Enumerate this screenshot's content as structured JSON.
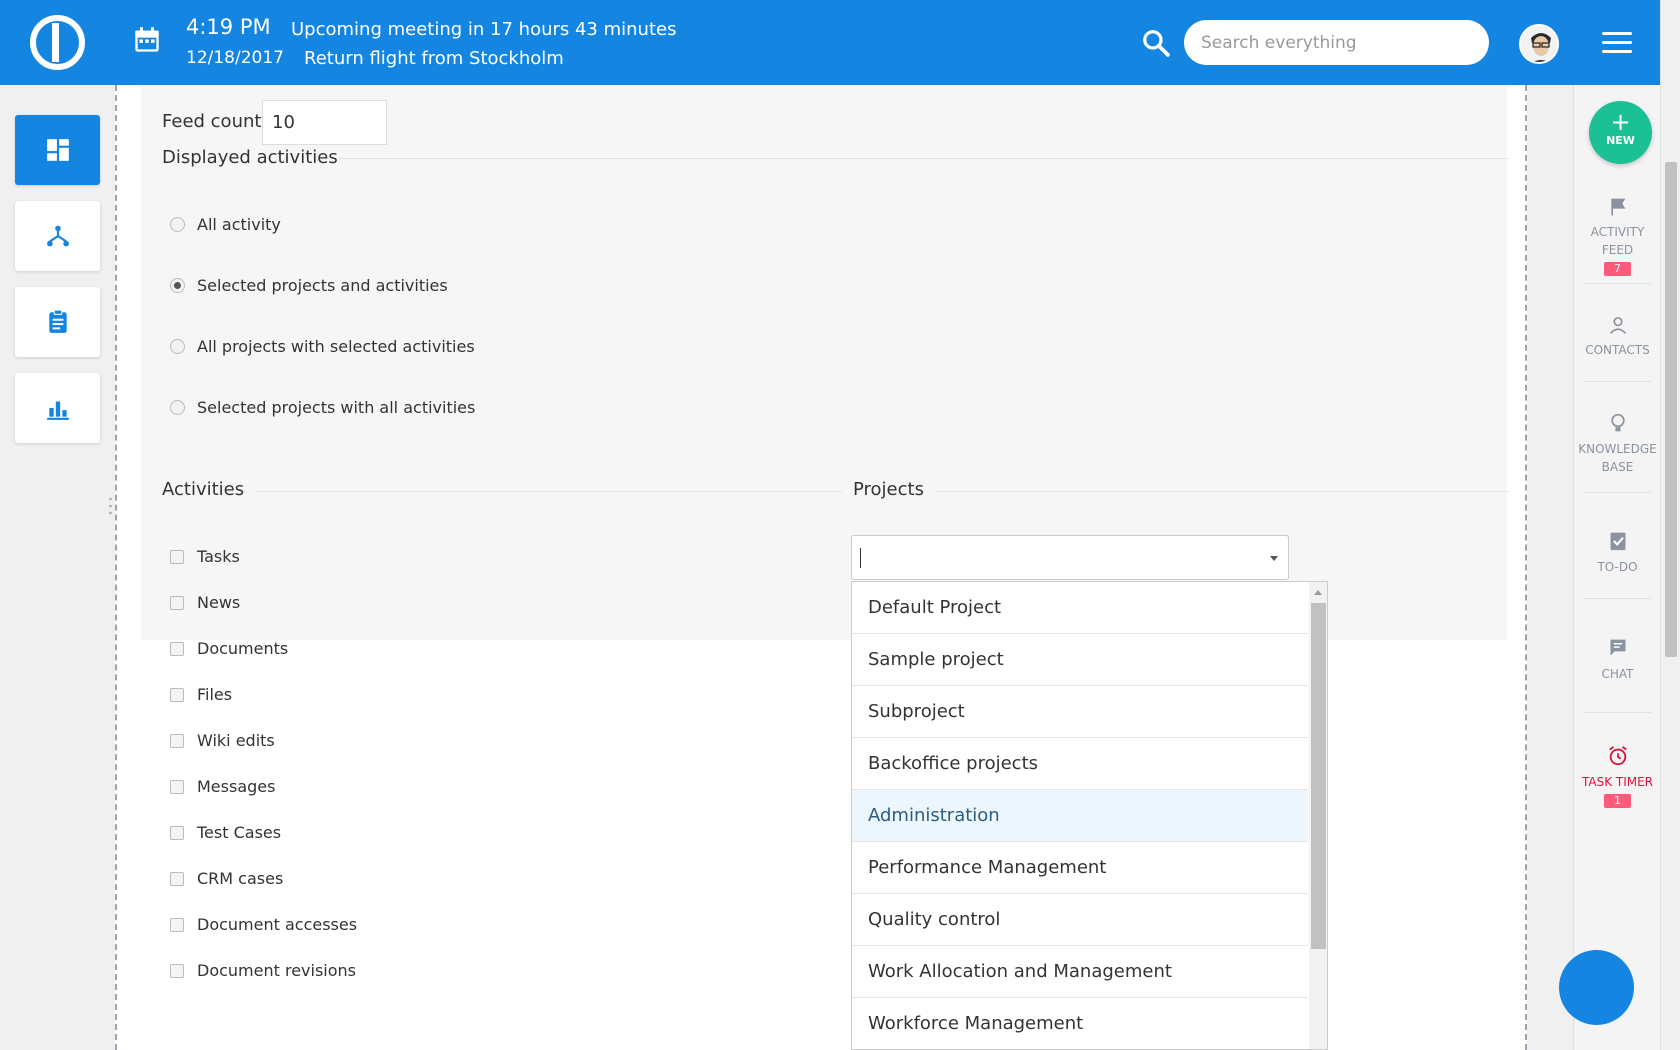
{
  "header": {
    "time": "4:19 PM",
    "date": "12/18/2017",
    "meeting": "Upcoming meeting in 17 hours 43 minutes",
    "flight": "Return flight from Stockholm",
    "search_placeholder": "Search everything"
  },
  "form": {
    "feed_count_label": "Feed count",
    "feed_count_value": "10",
    "displayed_activities_label": "Displayed activities",
    "radio_options": [
      "All activity",
      "Selected projects and activities",
      "All projects with selected activities",
      "Selected projects with all activities"
    ],
    "selected_radio": 1,
    "activities_label": "Activities",
    "projects_label": "Projects",
    "activities": [
      "Tasks",
      "News",
      "Documents",
      "Files",
      "Wiki edits",
      "Messages",
      "Test Cases",
      "CRM cases",
      "Document accesses",
      "Document revisions"
    ]
  },
  "dropdown": {
    "items": [
      "Default Project",
      "Sample project",
      "Subproject",
      "Backoffice projects",
      "Administration",
      "Performance Management",
      "Quality control",
      "Work Allocation and Management",
      "Workforce Management"
    ],
    "highlighted": 4
  },
  "rail": {
    "new_label": "NEW",
    "activity_feed_line1": "ACTIVITY",
    "activity_feed_line2": "FEED",
    "activity_feed_badge": "7",
    "contacts": "CONTACTS",
    "knowledge_line1": "KNOWLEDGE",
    "knowledge_line2": "BASE",
    "todo": "TO-DO",
    "chat": "CHAT",
    "timer": "TASK TIMER",
    "timer_badge": "1"
  },
  "colors": {
    "brand": "#1485e0",
    "new_button": "#1bc094",
    "badge": "#ff5a7a",
    "timer": "#d9143c"
  }
}
